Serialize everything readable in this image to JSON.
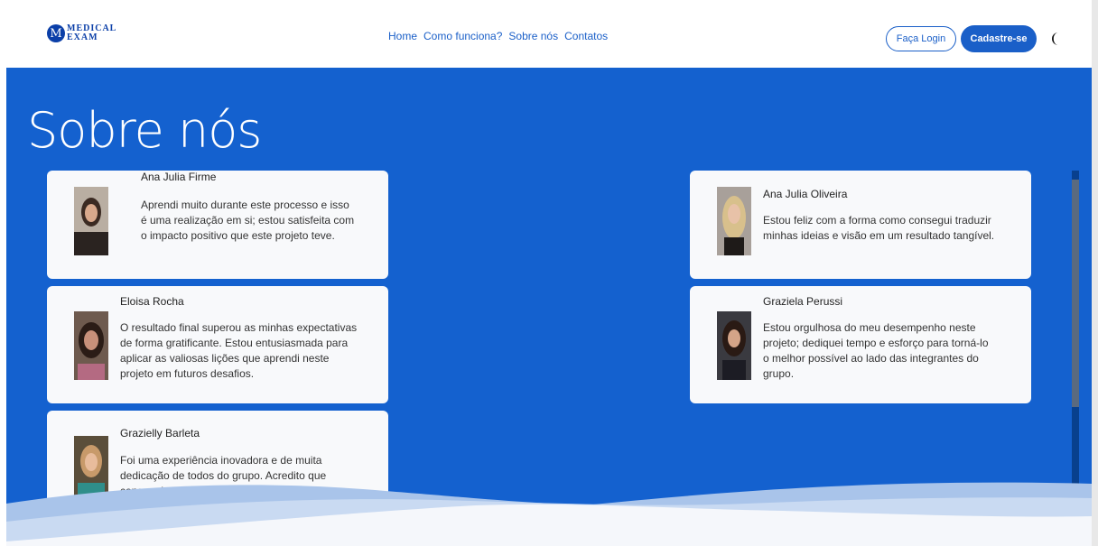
{
  "brand": {
    "letter": "M",
    "line1": "MEDICAL",
    "line2": "EXAM"
  },
  "nav": {
    "links": [
      "Home",
      "Como funciona?",
      "Sobre nós",
      "Contatos"
    ]
  },
  "actions": {
    "login": "Faça Login",
    "signup": "Cadastre-se"
  },
  "hero": {
    "title": "Sobre nós"
  },
  "team": [
    {
      "name": "Ana Julia Firme",
      "text": "Aprendi muito durante este processo e isso é uma realização em si; estou satisfeita com o impacto positivo que este projeto teve."
    },
    {
      "name": "Ana Julia Oliveira",
      "text": "Estou feliz com a forma como consegui traduzir minhas ideias e visão em um resultado tangível."
    },
    {
      "name": "Eloisa Rocha",
      "text": "O resultado final superou as minhas expectativas de forma gratificante. Estou entusiasmada para aplicar as valiosas lições que aprendi neste projeto em futuros desafios."
    },
    {
      "name": "Graziela Perussi",
      "text": "Estou orgulhosa do meu desempenho neste projeto; dediquei tempo e esforço para torná-lo o melhor possível ao lado das integrantes do grupo."
    },
    {
      "name": "Grazielly Barleta",
      "text": "Foi uma experiência inovadora e de muita dedicação de todos do grupo. Acredito que conseguimos atingir nossos objetivos."
    }
  ],
  "colors": {
    "primary": "#1461cf",
    "card": "#f8f9fb"
  }
}
